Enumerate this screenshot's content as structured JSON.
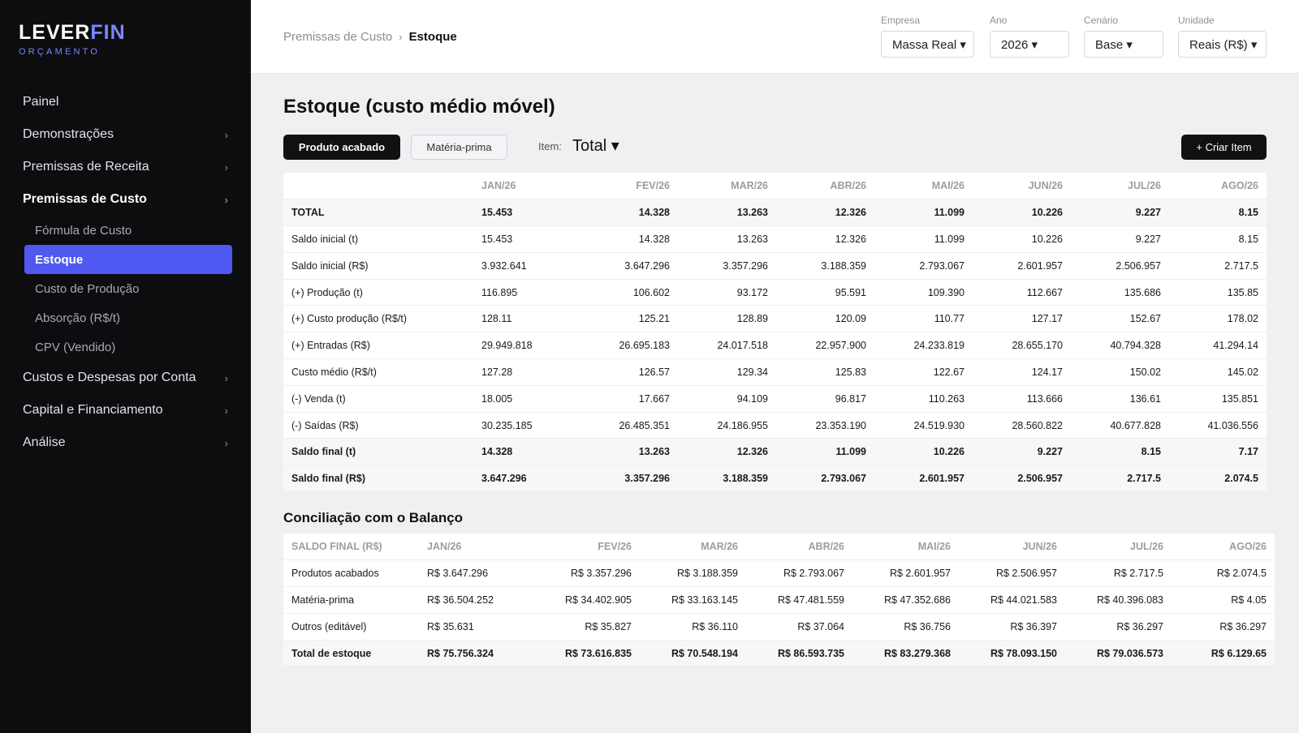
{
  "brand": {
    "name_part1": "LEVER",
    "name_part2": "FIN",
    "subtitle": "ORÇAMENTO"
  },
  "sidebar": {
    "items": [
      {
        "label": "Painel"
      },
      {
        "label": "Demonstrações",
        "chevron": "›"
      },
      {
        "label": "Premissas de Receita",
        "chevron": "›"
      },
      {
        "label": "Premissas de Custo",
        "chevron": "›"
      },
      {
        "label": "Custos e Despesas por Conta",
        "chevron": "›"
      },
      {
        "label": "Capital e Financiamento",
        "chevron": "›"
      },
      {
        "label": "Análise",
        "chevron": "›"
      }
    ],
    "sub_items": [
      {
        "label": "Fórmula de Custo"
      },
      {
        "label": "Estoque"
      },
      {
        "label": "Custo de Produção"
      },
      {
        "label": "Absorção (R$/t)"
      },
      {
        "label": "CPV (Vendido)"
      }
    ]
  },
  "header": {
    "breadcrumb": {
      "parent": "Premissas de Custo",
      "separator": "›",
      "current": "Estoque"
    },
    "filters": [
      {
        "label": "Empresa",
        "value": "Massa Real ▾"
      },
      {
        "label": "Ano",
        "value": "2026 ▾"
      },
      {
        "label": "Cenário",
        "value": "Base ▾"
      },
      {
        "label": "Unidade",
        "value": "Reais (R$) ▾"
      }
    ]
  },
  "main": {
    "title": "Estoque (custo médio móvel)",
    "tabs": [
      "Produto acabado",
      "Matéria-prima"
    ],
    "item_label": "Item:",
    "item_value": "Total ▾",
    "create_button": "+ Criar Item",
    "stock_table": {
      "columns": [
        "",
        "JAN/26",
        "FEV/26",
        "MAR/26",
        "ABR/26",
        "MAI/26",
        "JUN/26",
        "JUL/26",
        "AGO/26"
      ],
      "rows": [
        [
          "TOTAL",
          "15.453",
          "14.328",
          "13.263",
          "12.326",
          "11.099",
          "10.226",
          "9.227",
          "8.15"
        ],
        [
          "Saldo inicial (t)",
          "15.453",
          "14.328",
          "13.263",
          "12.326",
          "11.099",
          "10.226",
          "9.227",
          "8.15"
        ],
        [
          "Saldo inicial (R$)",
          "3.932.641",
          "3.647.296",
          "3.357.296",
          "3.188.359",
          "2.793.067",
          "2.601.957",
          "2.506.957",
          "2.717.5"
        ],
        [
          "(+) Produção (t)",
          "116.895",
          "106.602",
          "93.172",
          "95.591",
          "109.390",
          "112.667",
          "135.686",
          "135.85"
        ],
        [
          "(+) Custo produção (R$/t)",
          "128.11",
          "125.21",
          "128.89",
          "120.09",
          "110.77",
          "127.17",
          "152.67",
          "178.02"
        ],
        [
          "(+) Entradas (R$)",
          "29.949.818",
          "26.695.183",
          "24.017.518",
          "22.957.900",
          "24.233.819",
          "28.655.170",
          "40.794.328",
          "41.294.14"
        ],
        [
          "Custo médio (R$/t)",
          "127.28",
          "126.57",
          "129.34",
          "125.83",
          "122.67",
          "124.17",
          "150.02",
          "145.02"
        ],
        [
          "(-) Venda (t)",
          "18.005",
          "17.667",
          "94.109",
          "96.817",
          "110.263",
          "113.666",
          "136.61",
          "135.851"
        ],
        [
          "(-) Saídas (R$)",
          "30.235.185",
          "26.485.351",
          "24.186.955",
          "23.353.190",
          "24.519.930",
          "28.560.822",
          "40.677.828",
          "41.036.556"
        ],
        [
          "Saldo final (t)",
          "14.328",
          "13.263",
          "12.326",
          "11.099",
          "10.226",
          "9.227",
          "8.15",
          "7.17"
        ],
        [
          "Saldo final (R$)",
          "3.647.296",
          "3.357.296",
          "3.188.359",
          "2.793.067",
          "2.601.957",
          "2.506.957",
          "2.717.5",
          "2.074.5"
        ]
      ],
      "bold_rows": [
        0,
        9,
        10
      ]
    },
    "reconciliation": {
      "title": "Conciliação com o Balanço",
      "columns": [
        "SALDO FINAL (R$)",
        "JAN/26",
        "FEV/26",
        "MAR/26",
        "ABR/26",
        "MAI/26",
        "JUN/26",
        "JUL/26",
        "AGO/26"
      ],
      "rows": [
        [
          "Produtos acabados",
          "R$ 3.647.296",
          "R$ 3.357.296",
          "R$ 3.188.359",
          "R$ 2.793.067",
          "R$ 2.601.957",
          "R$ 2.506.957",
          "R$ 2.717.5",
          "R$ 2.074.5"
        ],
        [
          "Matéria-prima",
          "R$ 36.504.252",
          "R$ 34.402.905",
          "R$ 33.163.145",
          "R$ 47.481.559",
          "R$ 47.352.686",
          "R$ 44.021.583",
          "R$ 40.396.083",
          "R$ 4.05"
        ],
        [
          "Outros (editável)",
          "R$ 35.631",
          "R$ 35.827",
          "R$ 36.110",
          "R$ 37.064",
          "R$ 36.756",
          "R$ 36.397",
          "R$ 36.297",
          "R$ 36.297"
        ],
        [
          "Total de estoque",
          "R$ 75.756.324",
          "R$ 73.616.835",
          "R$ 70.548.194",
          "R$ 86.593.735",
          "R$ 83.279.368",
          "R$ 78.093.150",
          "R$ 79.036.573",
          "R$ 6.129.65"
        ]
      ],
      "bold_rows": [
        3
      ]
    }
  }
}
